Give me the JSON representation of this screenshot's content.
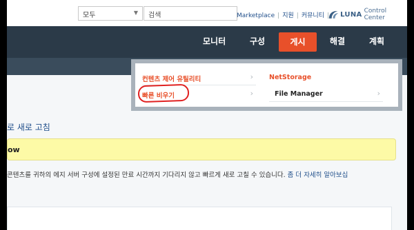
{
  "topbar": {
    "scope_select": "모두",
    "search_placeholder": "검색",
    "links": [
      "Marketplace",
      "지원",
      "커뮤니티"
    ],
    "logo": {
      "brand": "LUNA",
      "product": "Control Center"
    }
  },
  "nav": {
    "items": [
      {
        "label": "모니터"
      },
      {
        "label": "구성"
      },
      {
        "label": "게시",
        "active": true
      },
      {
        "label": "해결"
      },
      {
        "label": "계획"
      }
    ]
  },
  "dropdown": {
    "left": [
      {
        "label": "컨텐츠 제어 유틸리티"
      },
      {
        "label": "빠른 비우기",
        "highlighted": true
      }
    ],
    "right": [
      {
        "label": "NetStorage"
      },
      {
        "label": "File Manager"
      }
    ]
  },
  "content": {
    "title": "로 새로 고침",
    "notice": "ow",
    "description": "콘텐츠를 귀하의 에지 서버 구성에 설정된 만료 시간까지 기다리지 않고 빠르게 새로 고칠 수 있습니다.",
    "description_link": "좀 더 자세히 알아보십"
  },
  "colors": {
    "nav_bg": "#2b3a48",
    "accent": "#e8502a",
    "notice_bg": "#fdfaa6",
    "link": "#1f4e8a",
    "annotation": "#e02020"
  }
}
